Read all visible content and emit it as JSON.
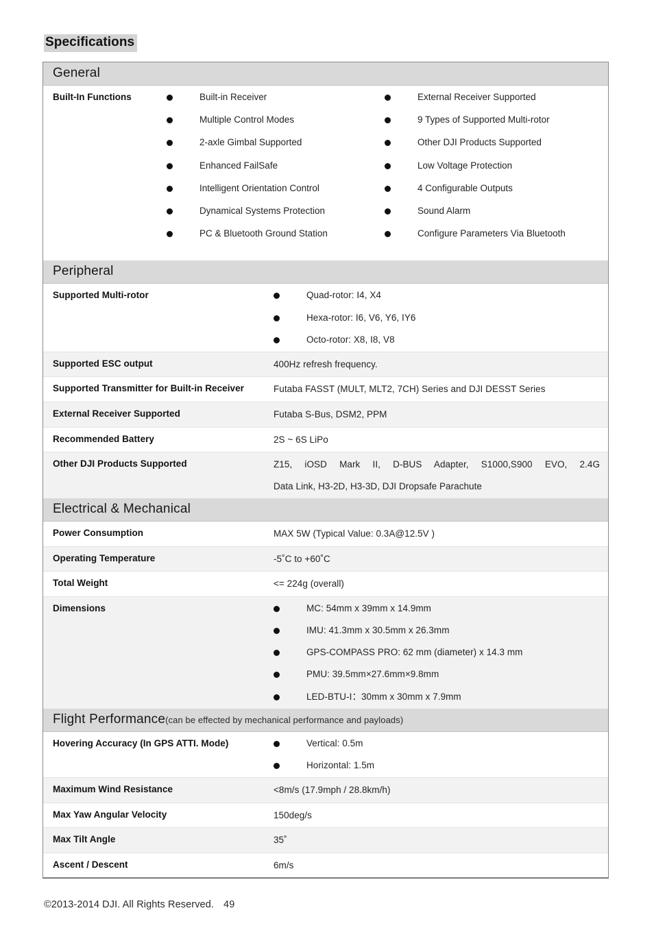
{
  "document": {
    "title": "Specifications",
    "footer_copyright": "©2013-2014 DJI. All Rights Reserved.",
    "footer_page_number": "49"
  },
  "sections": {
    "general": {
      "heading": "General",
      "row_label": "Built-In Functions",
      "column_left": [
        "Built-in Receiver",
        "Multiple Control Modes",
        "2-axle Gimbal Supported",
        "Enhanced FailSafe",
        "Intelligent Orientation Control",
        "Dynamical Systems Protection",
        "PC & Bluetooth Ground Station"
      ],
      "column_right": [
        "External Receiver Supported",
        "9 Types of Supported Multi-rotor",
        "Other DJI Products Supported",
        "Low Voltage Protection",
        "4 Configurable Outputs",
        "Sound Alarm",
        "Configure Parameters Via Bluetooth"
      ]
    },
    "peripheral": {
      "heading": "Peripheral",
      "rows": {
        "multirotor_label": "Supported Multi-rotor",
        "multirotor_items": [
          "Quad-rotor: I4, X4",
          "Hexa-rotor: I6, V6, Y6, IY6",
          "Octo-rotor: X8, I8, V8"
        ],
        "esc_label": "Supported ESC output",
        "esc_value": "400Hz refresh frequency.",
        "transmitter_label": "Supported Transmitter for Built-in Receiver",
        "transmitter_value": "Futaba FASST (MULT, MLT2, 7CH) Series and DJI DESST Series",
        "ext_receiver_label": "External Receiver Supported",
        "ext_receiver_value": "Futaba S-Bus, DSM2, PPM",
        "battery_label": "Recommended Battery",
        "battery_value": "2S ~ 6S LiPo",
        "other_products_label": "Other DJI Products Supported",
        "other_products_line1": "Z15, iOSD Mark II, D-BUS Adapter, S1000,S900 EVO, 2.4G",
        "other_products_line2": "Data Link, H3-2D, H3-3D, DJI Dropsafe Parachute"
      }
    },
    "electrical": {
      "heading": "Electrical & Mechanical",
      "rows": {
        "power_label": "Power Consumption",
        "power_value": "MAX 5W (Typical Value: 0.3A@12.5V )",
        "temp_label": "Operating Temperature",
        "temp_value": "-5˚C to +60˚C",
        "weight_label": "Total Weight",
        "weight_value": "<= 224g (overall)",
        "dimensions_label": "Dimensions",
        "dimensions_items": [
          "MC: 54mm x 39mm x 14.9mm",
          "IMU: 41.3mm x 30.5mm x 26.3mm",
          "GPS-COMPASS PRO: 62 mm (diameter) x 14.3 mm",
          "PMU: 39.5mm×27.6mm×9.8mm",
          "LED-BTU-I：30mm x 30mm x 7.9mm"
        ]
      }
    },
    "flight": {
      "heading": "Flight Performance",
      "heading_note": "(can be effected by mechanical performance and payloads)",
      "rows": {
        "hovering_label": "Hovering Accuracy (In GPS ATTI. Mode)",
        "hovering_items": [
          "Vertical:   0.5m",
          "Horizontal:   1.5m"
        ],
        "wind_label": "Maximum Wind Resistance",
        "wind_value": "<8m/s (17.9mph / 28.8km/h)",
        "yaw_label": "Max Yaw Angular Velocity",
        "yaw_value": "150deg/s",
        "tilt_label": "Max Tilt Angle",
        "tilt_value": "35˚",
        "ascent_label": "Ascent / Descent",
        "ascent_value": "6m/s"
      }
    }
  },
  "colors": {
    "section_band": "#d9d9d9",
    "row_shade": "#f2f2f2",
    "title_highlight": "#d4d4d4",
    "border": "#8a8a8a"
  }
}
